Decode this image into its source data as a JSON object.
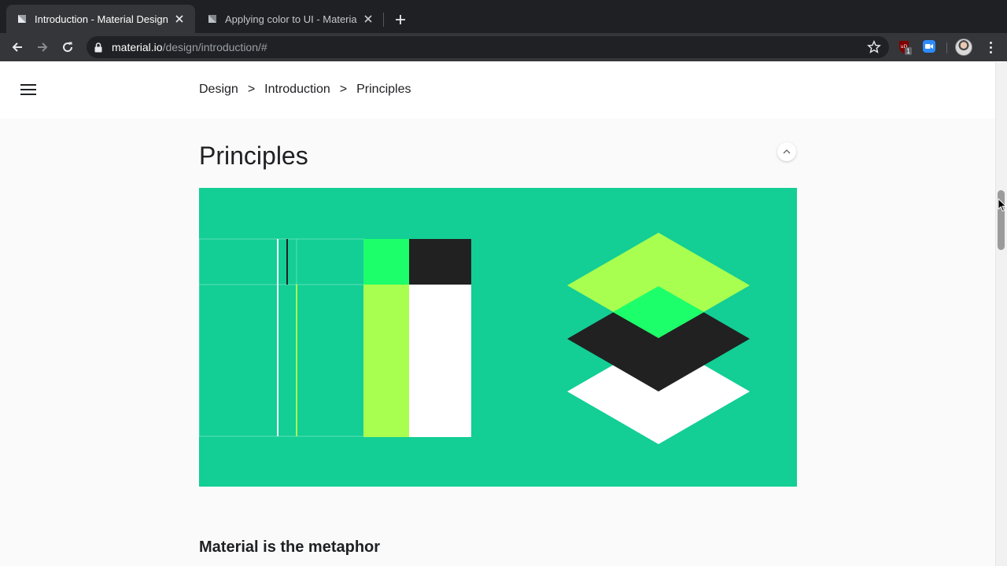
{
  "browser": {
    "tabs": [
      {
        "title": "Introduction - Material Design",
        "active": true
      },
      {
        "title": "Applying color to UI - Material",
        "active": false
      }
    ],
    "url": {
      "host": "material.io",
      "path": "/design/introduction/#"
    },
    "extensions": {
      "ublock_badge": "1"
    }
  },
  "header": {
    "breadcrumb": [
      "Design",
      "Introduction",
      "Principles"
    ],
    "separator": ">"
  },
  "main": {
    "section_title": "Principles",
    "subheading": "Material is the metaphor"
  },
  "colors": {
    "hero_bg": "#13ce95",
    "lime": "#a9ff4f",
    "green": "#1dff6a",
    "dark": "#212121",
    "white": "#ffffff"
  }
}
